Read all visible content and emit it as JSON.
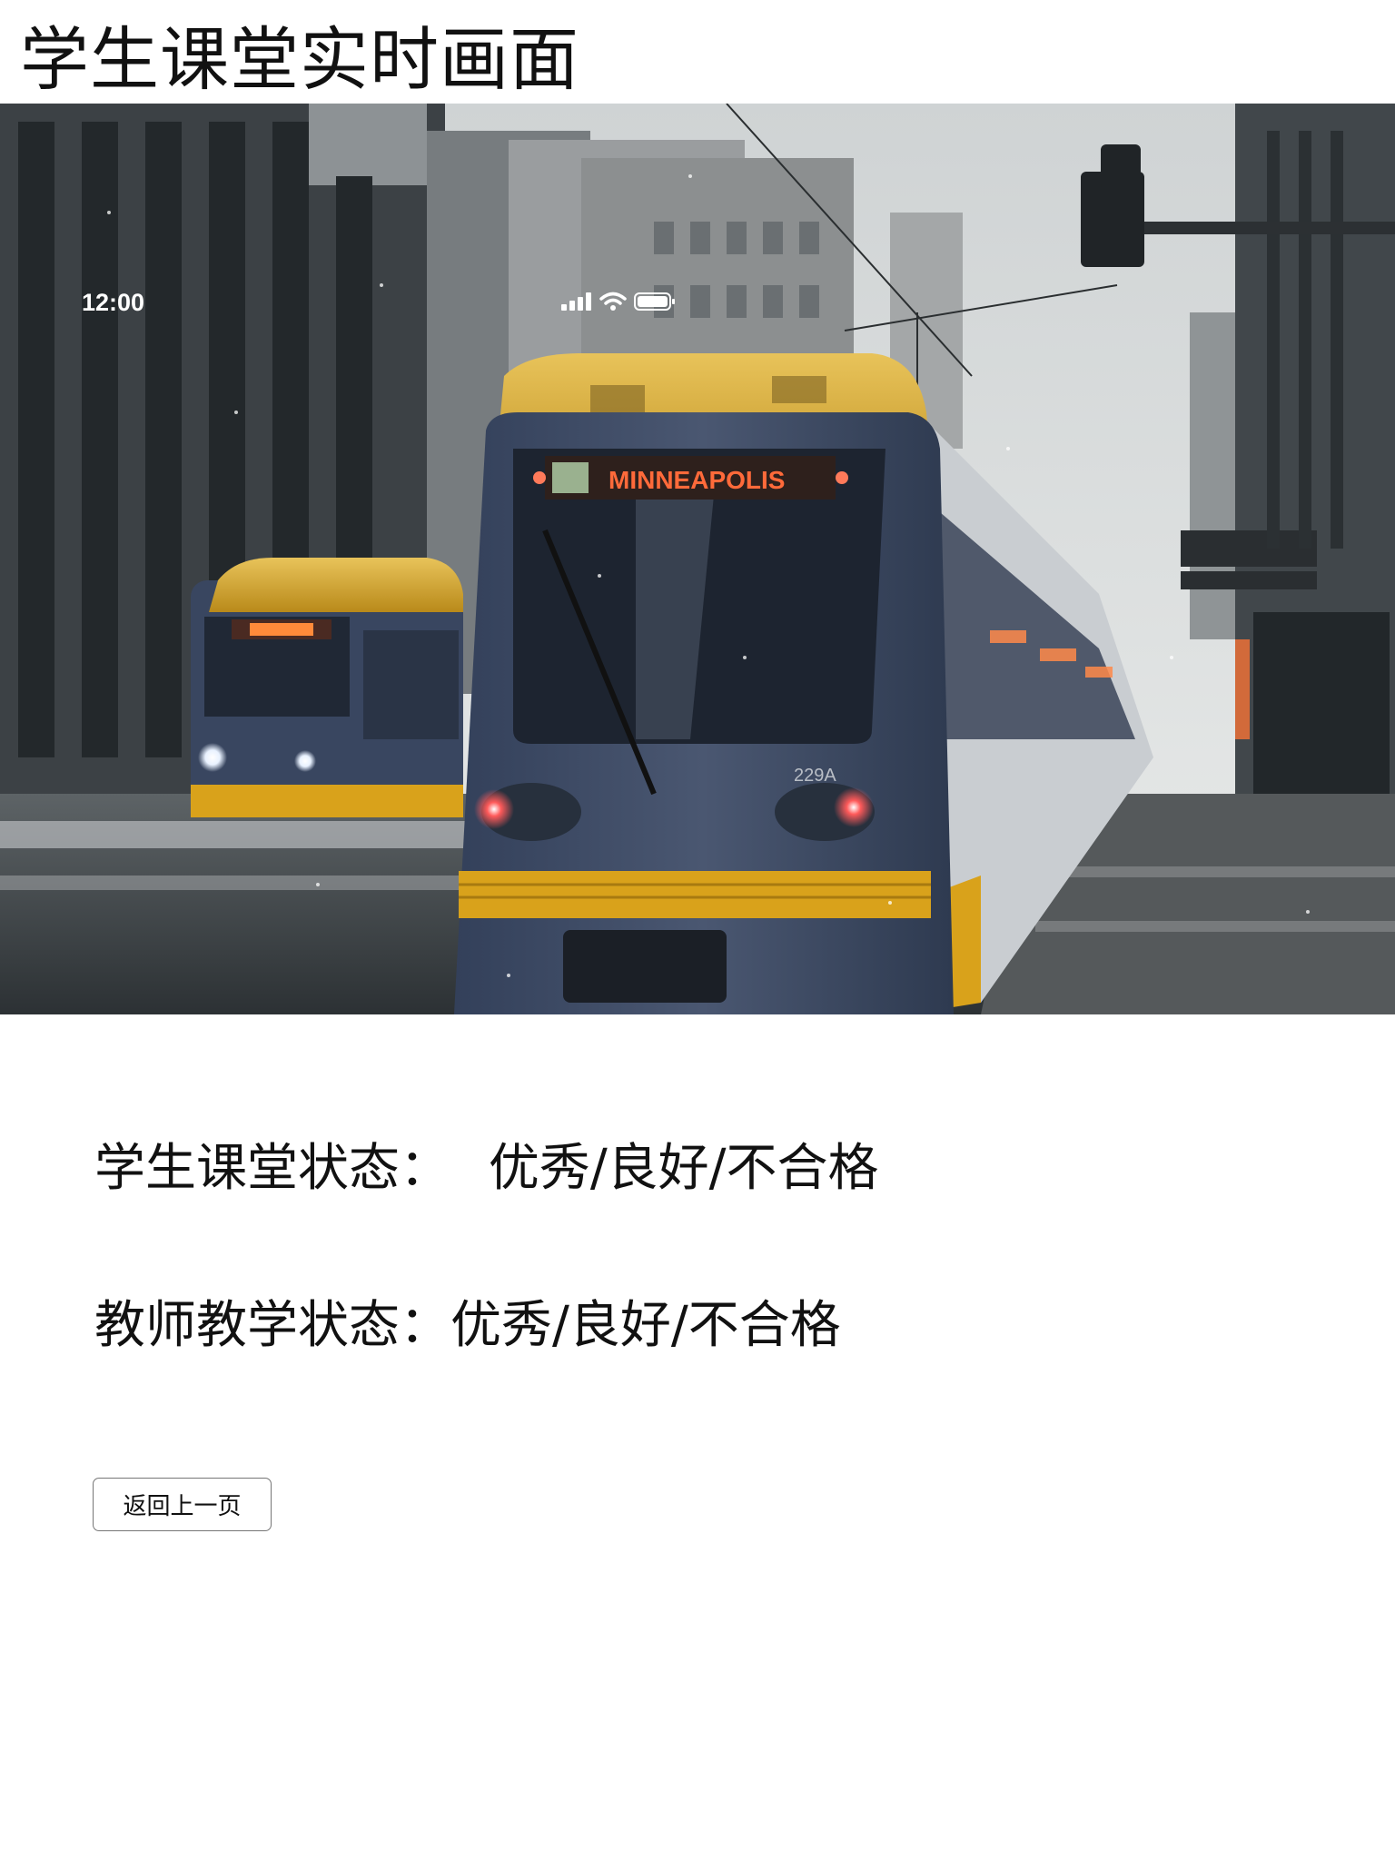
{
  "page": {
    "title": "学生课堂实时画面"
  },
  "video": {
    "status_bar": {
      "time": "12:00",
      "icons": [
        "cellular-signal-icon",
        "wifi-icon",
        "battery-icon"
      ]
    },
    "destination_sign": "MINNEAPOLIS",
    "vehicle_number": "229A"
  },
  "evaluation": {
    "student_label": "学生课堂状态：",
    "student_options": "优秀/良好/不合格",
    "teacher_label": "教师教学状态：",
    "teacher_options": "优秀/良好/不合格"
  },
  "actions": {
    "back_label": "返回上一页"
  },
  "colors": {
    "tram_yellow": "#d9a21b",
    "tram_blue": "#3d4a5f",
    "sign_orange": "#ff6a3a"
  }
}
